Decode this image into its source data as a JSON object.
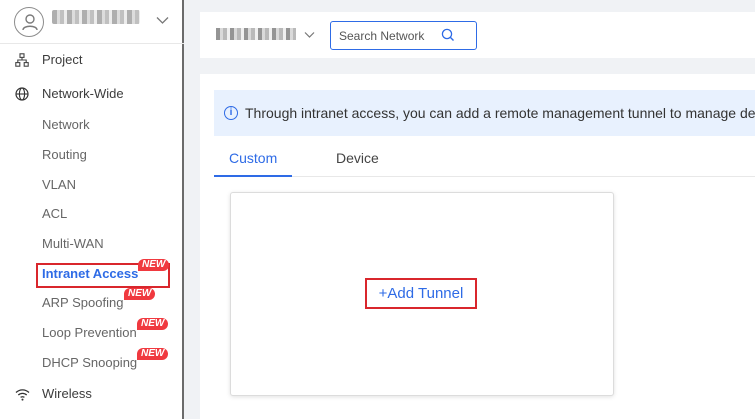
{
  "sidebar": {
    "user": {
      "name_blurred": true
    },
    "top_items": [
      {
        "label": "Project",
        "icon": "sitemap-icon"
      },
      {
        "label": "Network-Wide",
        "icon": "globe-icon"
      }
    ],
    "sub_items": [
      {
        "label": "Network"
      },
      {
        "label": "Routing"
      },
      {
        "label": "VLAN"
      },
      {
        "label": "ACL"
      },
      {
        "label": "Multi-WAN"
      },
      {
        "label": "Intranet Access",
        "badge": "NEW",
        "active": true
      },
      {
        "label": "ARP Spoofing",
        "badge": "NEW"
      },
      {
        "label": "Loop Prevention",
        "badge": "NEW"
      },
      {
        "label": "DHCP Snooping",
        "badge": "NEW"
      }
    ],
    "bottom_items": [
      {
        "label": "Wireless",
        "icon": "wifi-icon"
      }
    ]
  },
  "topbar": {
    "network_selector_blurred": true,
    "search": {
      "placeholder": "Search Network",
      "value": ""
    }
  },
  "main": {
    "info_text": "Through intranet access, you can add a remote management tunnel to manage de",
    "tabs": [
      {
        "label": "Custom",
        "active": true
      },
      {
        "label": "Device",
        "active": false
      }
    ],
    "add_tunnel_label": "+Add Tunnel"
  },
  "colors": {
    "accent": "#2e6be6",
    "badge": "#f0393f",
    "highlight_border": "#d9262c",
    "info_bg": "#e8f1fe"
  }
}
